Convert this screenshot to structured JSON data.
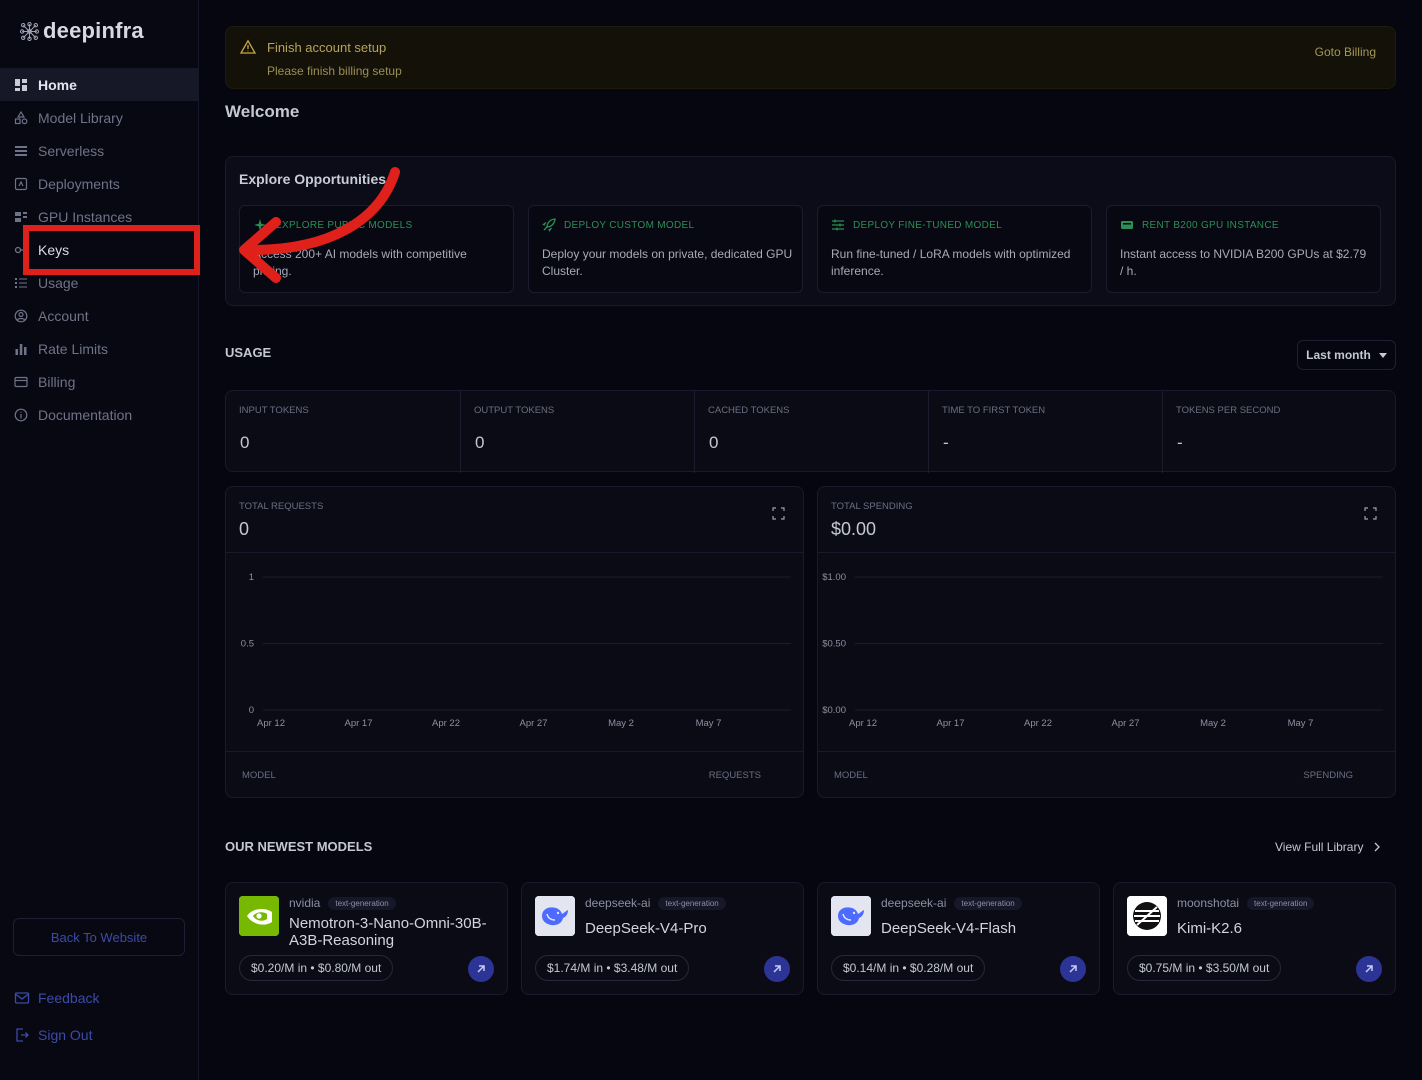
{
  "brand": {
    "name": "deepinfra"
  },
  "sidebar": {
    "items": [
      {
        "label": "Home",
        "icon": "dashboard-icon",
        "active": true
      },
      {
        "label": "Model Library",
        "icon": "shapes-icon"
      },
      {
        "label": "Serverless",
        "icon": "server-icon"
      },
      {
        "label": "Deployments",
        "icon": "deploy-icon"
      },
      {
        "label": "GPU Instances",
        "icon": "gpu-icon"
      },
      {
        "label": "Keys",
        "icon": "key-icon"
      },
      {
        "label": "Usage",
        "icon": "list-icon"
      },
      {
        "label": "Account",
        "icon": "user-circle-icon"
      },
      {
        "label": "Rate Limits",
        "icon": "bar-chart-icon"
      },
      {
        "label": "Billing",
        "icon": "card-icon"
      },
      {
        "label": "Documentation",
        "icon": "info-icon"
      }
    ],
    "back_to_website": "Back To Website",
    "feedback": "Feedback",
    "sign_out": "Sign Out"
  },
  "banner": {
    "title": "Finish account setup",
    "subtitle": "Please finish billing setup",
    "action": "Goto Billing"
  },
  "welcome": "Welcome",
  "explore": {
    "title": "Explore Opportunities",
    "cards": [
      {
        "title": "Explore Public Models",
        "desc": "Access 200+ AI models with competitive pricing."
      },
      {
        "title": "Deploy Custom Model",
        "desc": "Deploy your models on private, dedicated GPU Cluster."
      },
      {
        "title": "Deploy Fine-Tuned Model",
        "desc": "Run fine-tuned / LoRA models with optimized inference."
      },
      {
        "title": "Rent B200 GPU Instance",
        "desc": "Instant access to NVIDIA B200 GPUs at $2.79 / h."
      }
    ]
  },
  "usage": {
    "title": "USAGE",
    "range": "Last month",
    "stats": [
      {
        "label": "Input Tokens",
        "value": "0"
      },
      {
        "label": "Output Tokens",
        "value": "0"
      },
      {
        "label": "Cached Tokens",
        "value": "0"
      },
      {
        "label": "Time To First Token",
        "value": "-"
      },
      {
        "label": "Tokens Per Second",
        "value": "-"
      }
    ]
  },
  "charts": {
    "requests": {
      "label": "Total Requests",
      "value": "0",
      "foot_left": "Model",
      "foot_right": "Requests"
    },
    "spending": {
      "label": "Total Spending",
      "value": "$0.00",
      "foot_left": "Model",
      "foot_right": "Spending"
    }
  },
  "chart_data": [
    {
      "type": "line",
      "x_ticks": [
        "Apr 12",
        "Apr 17",
        "Apr 22",
        "Apr 27",
        "May 2",
        "May 7"
      ],
      "y_ticks": [
        "1",
        "0.5",
        "0"
      ],
      "ylim": [
        0,
        1
      ],
      "series": [],
      "grid": true
    },
    {
      "type": "line",
      "x_ticks": [
        "Apr 12",
        "Apr 17",
        "Apr 22",
        "Apr 27",
        "May 2",
        "May 7"
      ],
      "y_ticks": [
        "$1.00",
        "$0.50",
        "$0.00"
      ],
      "ylim": [
        0,
        1
      ],
      "series": [],
      "grid": true
    }
  ],
  "newest": {
    "title": "OUR NEWEST MODELS",
    "view_all": "View Full Library",
    "models": [
      {
        "org": "nvidia",
        "tag": "text-generation",
        "name": "Nemotron-3-Nano-Omni-30B-A3B-Reasoning",
        "price": "$0.20/M in • $0.80/M out",
        "logo": "nvidia-logo"
      },
      {
        "org": "deepseek-ai",
        "tag": "text-generation",
        "name": "DeepSeek-V4-Pro",
        "price": "$1.74/M in • $3.48/M out",
        "logo": "deepseek-logo"
      },
      {
        "org": "deepseek-ai",
        "tag": "text-generation",
        "name": "DeepSeek-V4-Flash",
        "price": "$0.14/M in • $0.28/M out",
        "logo": "deepseek-logo"
      },
      {
        "org": "moonshotai",
        "tag": "text-generation",
        "name": "Kimi-K2.6",
        "price": "$0.75/M in • $3.50/M out",
        "logo": "moonshot-logo"
      }
    ]
  },
  "colors": {
    "accent": "#2c3596",
    "highlight": "#e0201a",
    "explore_green": "#2b8f55"
  }
}
